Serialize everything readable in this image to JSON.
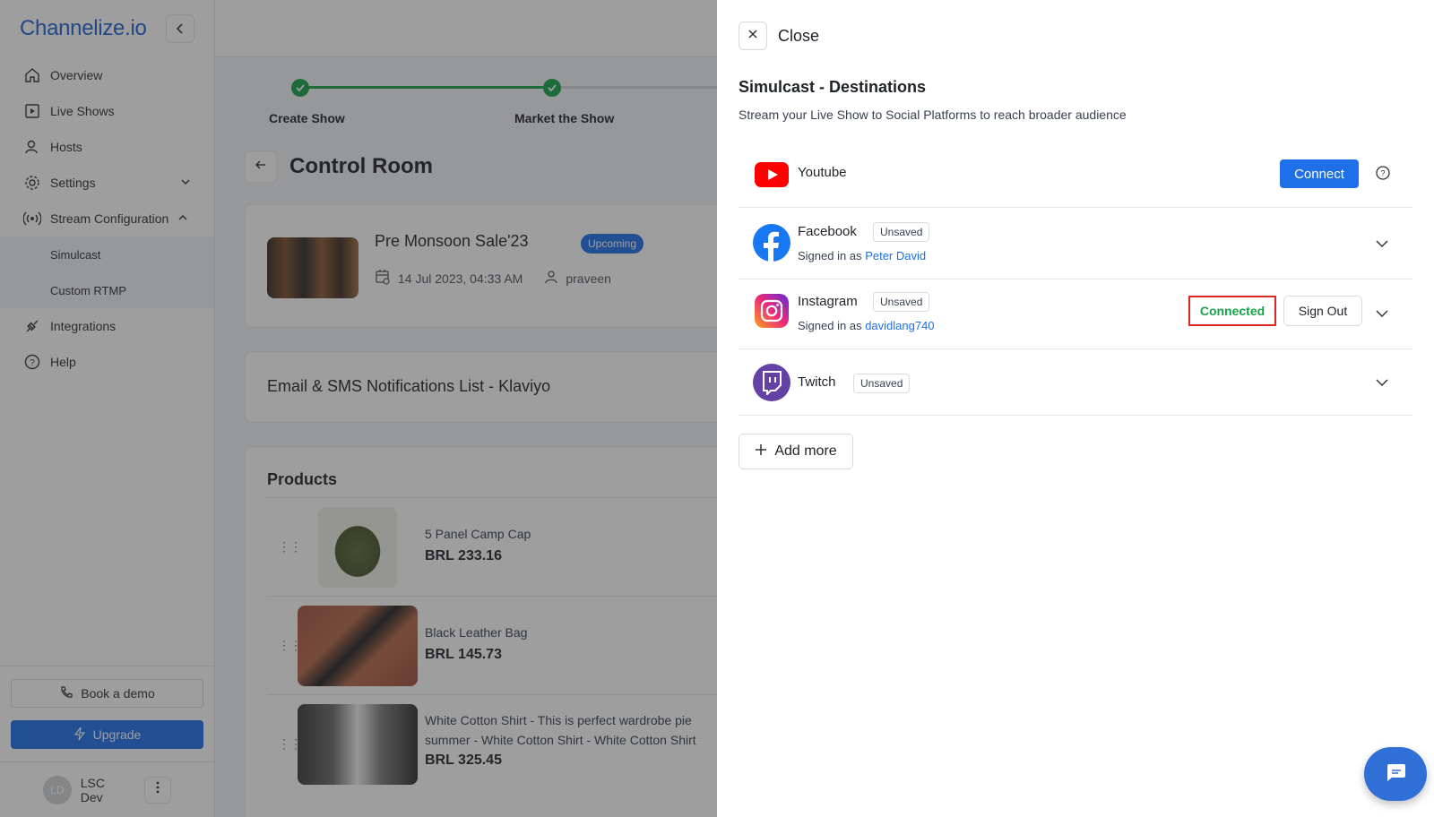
{
  "sidebar": {
    "logo": "Channelize.io",
    "items": [
      {
        "label": "Overview"
      },
      {
        "label": "Live Shows"
      },
      {
        "label": "Hosts"
      },
      {
        "label": "Settings"
      },
      {
        "label": "Stream Configuration"
      }
    ],
    "sub_items": [
      {
        "label": "Simulcast"
      },
      {
        "label": "Custom RTMP"
      }
    ],
    "items_after": [
      {
        "label": "Integrations"
      },
      {
        "label": "Help"
      }
    ],
    "book_demo": "Book a demo",
    "upgrade": "Upgrade",
    "user": {
      "initials": "LD",
      "name": "LSC Dev"
    }
  },
  "main": {
    "steps": [
      {
        "label": "Create Show"
      },
      {
        "label": "Market the Show"
      }
    ],
    "page_title": "Control Room",
    "show": {
      "title": "Pre Monsoon Sale'23",
      "status": "Upcoming",
      "datetime": "14 Jul 2023, 04:33 AM",
      "host": "praveen"
    },
    "klaviyo_title": "Email & SMS Notifications List - Klaviyo",
    "products_title": "Products",
    "products": [
      {
        "name": "5 Panel Camp Cap",
        "price": "BRL 233.16"
      },
      {
        "name": "Black Leather Bag",
        "price": "BRL 145.73"
      },
      {
        "name": "White Cotton Shirt - This is perfect wardrobe piece for summer - White Cotton Shirt - White Cotton Shirt",
        "line1": "White Cotton Shirt - This is perfect wardrobe pie",
        "line2": "summer - White Cotton Shirt - White Cotton Shirt",
        "price": "BRL 325.45"
      }
    ]
  },
  "drawer": {
    "close_label": "Close",
    "title": "Simulcast - Destinations",
    "subtitle": "Stream your Live Show to Social Platforms to reach broader audience",
    "destinations": {
      "youtube": {
        "name": "Youtube",
        "action": "Connect"
      },
      "facebook": {
        "name": "Facebook",
        "badge": "Unsaved",
        "signed_prefix": "Signed in as",
        "account": "Peter David"
      },
      "instagram": {
        "name": "Instagram",
        "badge": "Unsaved",
        "signed_prefix": "Signed in as",
        "account": "davidlang740",
        "status": "Connected",
        "action": "Sign Out"
      },
      "twitch": {
        "name": "Twitch",
        "badge": "Unsaved"
      }
    },
    "add_more": "Add more"
  },
  "colors": {
    "accent": "#1e6fe8",
    "success": "#16a34a",
    "highlight_border": "#dc2626",
    "youtube": "#ff0000",
    "facebook": "#1877f2",
    "twitch": "#6441a5"
  }
}
